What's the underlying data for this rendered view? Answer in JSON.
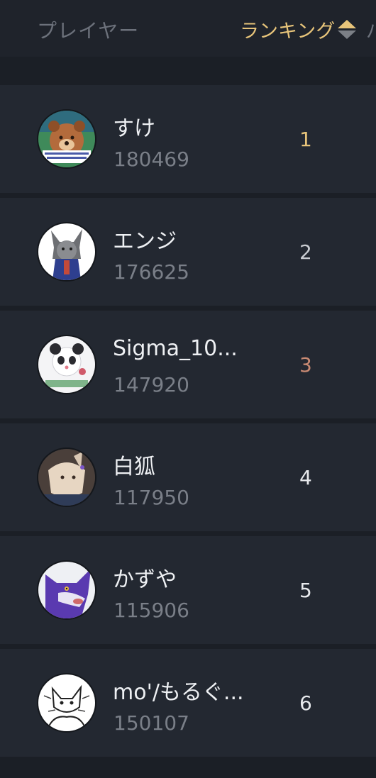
{
  "header": {
    "player_label": "プレイヤー",
    "ranking_label": "ランキング",
    "next_label": "パ",
    "sort_icon": "sort-updown-icon"
  },
  "colors": {
    "background": "#1b1f26",
    "row": "#232831",
    "gold": "#e7c47a",
    "bronze": "#c98a73",
    "rank_default": "#e8eaed",
    "score": "#7a7f88"
  },
  "players": [
    {
      "name": "すけ",
      "score": "180469",
      "rank": "1",
      "avatar": "bear-avatar-icon"
    },
    {
      "name": "エンジ",
      "score": "176625",
      "rank": "2",
      "avatar": "grey-wolf-avatar-icon"
    },
    {
      "name": "Sigma_10...",
      "score": "147920",
      "rank": "3",
      "avatar": "white-panda-avatar-icon"
    },
    {
      "name": "白狐",
      "score": "117950",
      "rank": "4",
      "avatar": "white-fox-avatar-icon"
    },
    {
      "name": "かずや",
      "score": "115906",
      "rank": "5",
      "avatar": "purple-wolf-avatar-icon"
    },
    {
      "name": "mo'/もるぐ...",
      "score": "150107",
      "rank": "6",
      "avatar": "sketch-avatar-icon"
    }
  ]
}
